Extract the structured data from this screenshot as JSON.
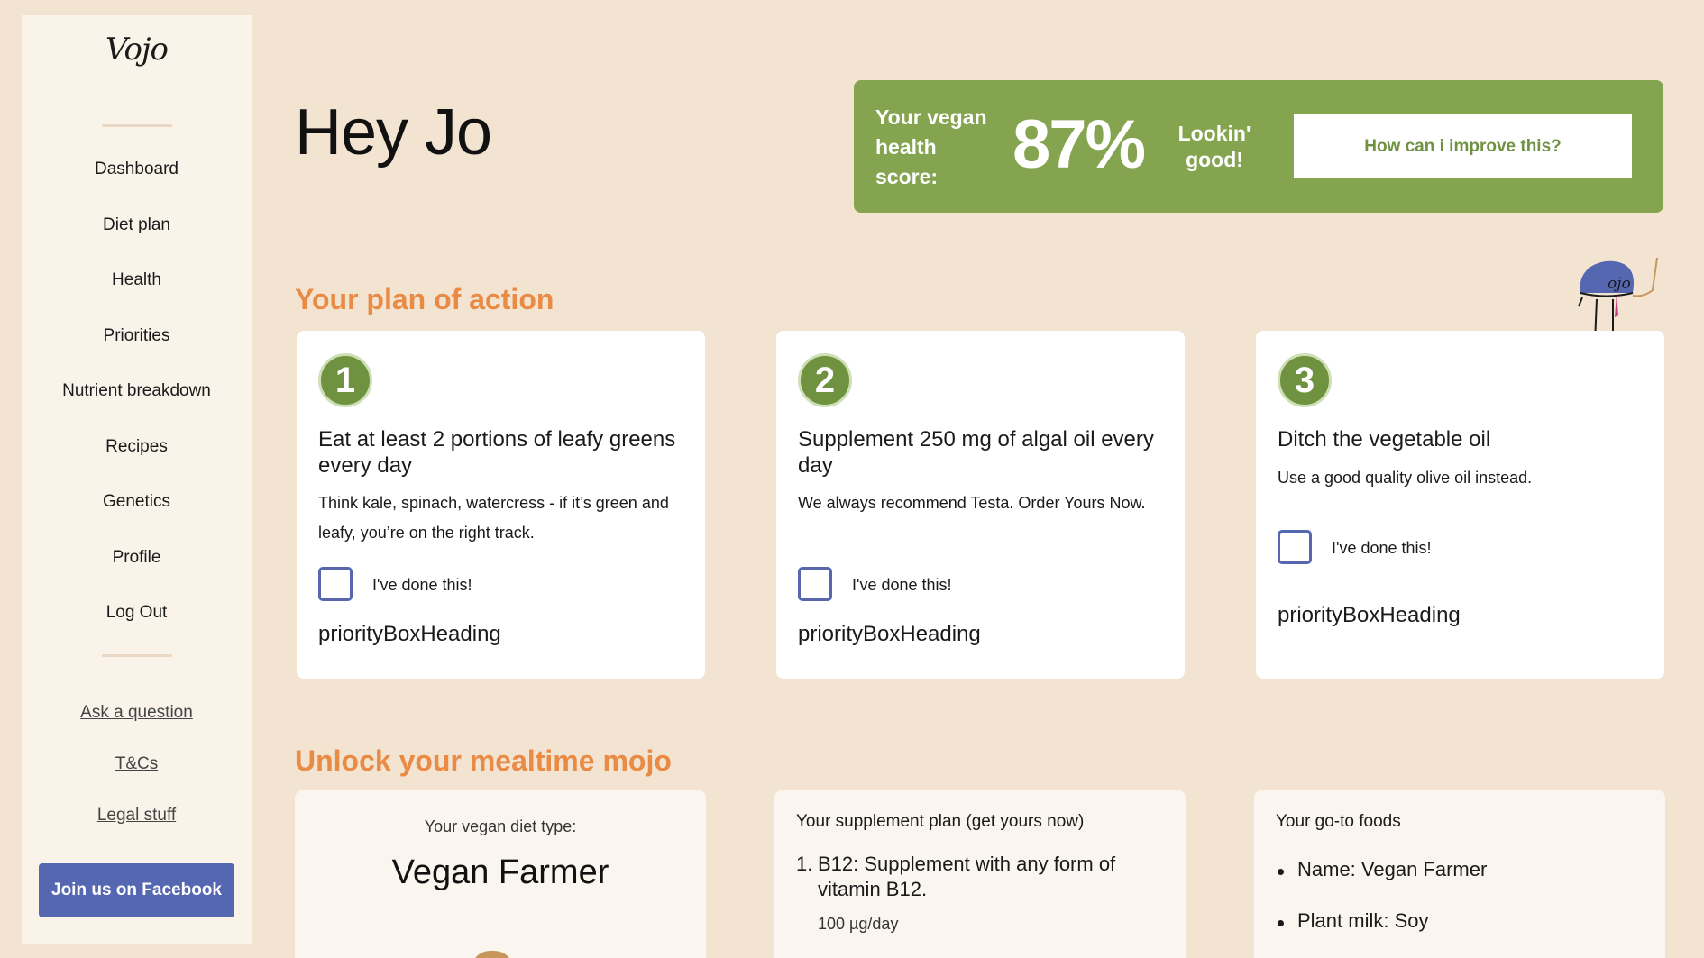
{
  "app": {
    "logo": "Vojo"
  },
  "sidebar": {
    "nav": [
      {
        "label": "Dashboard"
      },
      {
        "label": "Diet plan"
      },
      {
        "label": "Health"
      },
      {
        "label": "Priorities"
      },
      {
        "label": "Nutrient breakdown"
      },
      {
        "label": "Recipes"
      },
      {
        "label": "Genetics"
      },
      {
        "label": "Profile"
      },
      {
        "label": "Log Out"
      }
    ],
    "links": [
      {
        "label": "Ask a question"
      },
      {
        "label": "T&Cs"
      },
      {
        "label": "Legal stuff"
      }
    ],
    "facebook_button": "Join us on Facebook"
  },
  "header": {
    "greeting": "Hey Jo",
    "score": {
      "label": "Your vegan health score:",
      "value": "87%",
      "remark": "Lookin' good!",
      "button": "How can i improve this?"
    }
  },
  "plan": {
    "title": "Your plan of action",
    "cards": [
      {
        "number": "1",
        "title": "Eat at least 2 portions of leafy greens every day",
        "body": "Think kale, spinach, watercress - if it’s green and leafy, you’re on the right track.",
        "check_label": "I've done this!",
        "heading": "priorityBoxHeading"
      },
      {
        "number": "2",
        "title": "Supplement 250 mg of algal oil every day",
        "body": "We always recommend Testa. Order Yours Now.",
        "check_label": "I've done this!",
        "heading": "priorityBoxHeading"
      },
      {
        "number": "3",
        "title": "Ditch the vegetable oil",
        "body": "Use a good quality olive oil instead.",
        "check_label": "I've done this!",
        "heading": "priorityBoxHeading"
      }
    ]
  },
  "mealtime": {
    "title": "Unlock your mealtime mojo",
    "diet": {
      "label": "Your vegan diet type:",
      "type": "Vegan Farmer"
    },
    "supplements": {
      "heading": "Your supplement plan (get yours now)",
      "items": [
        {
          "number": "1.",
          "text": "B12: Supplement with any form of vitamin B12.",
          "dose": "100 µg/day"
        }
      ]
    },
    "foods": {
      "heading": "Your go-to foods",
      "items": [
        {
          "text": "Name: Vegan Farmer"
        },
        {
          "text": "Plant milk: Soy"
        }
      ]
    }
  },
  "colors": {
    "background": "#f3e4d1",
    "sidebar": "#faf3ea",
    "accent_green": "#84a44f",
    "accent_orange": "#e98a45",
    "accent_blue": "#5667b2"
  }
}
